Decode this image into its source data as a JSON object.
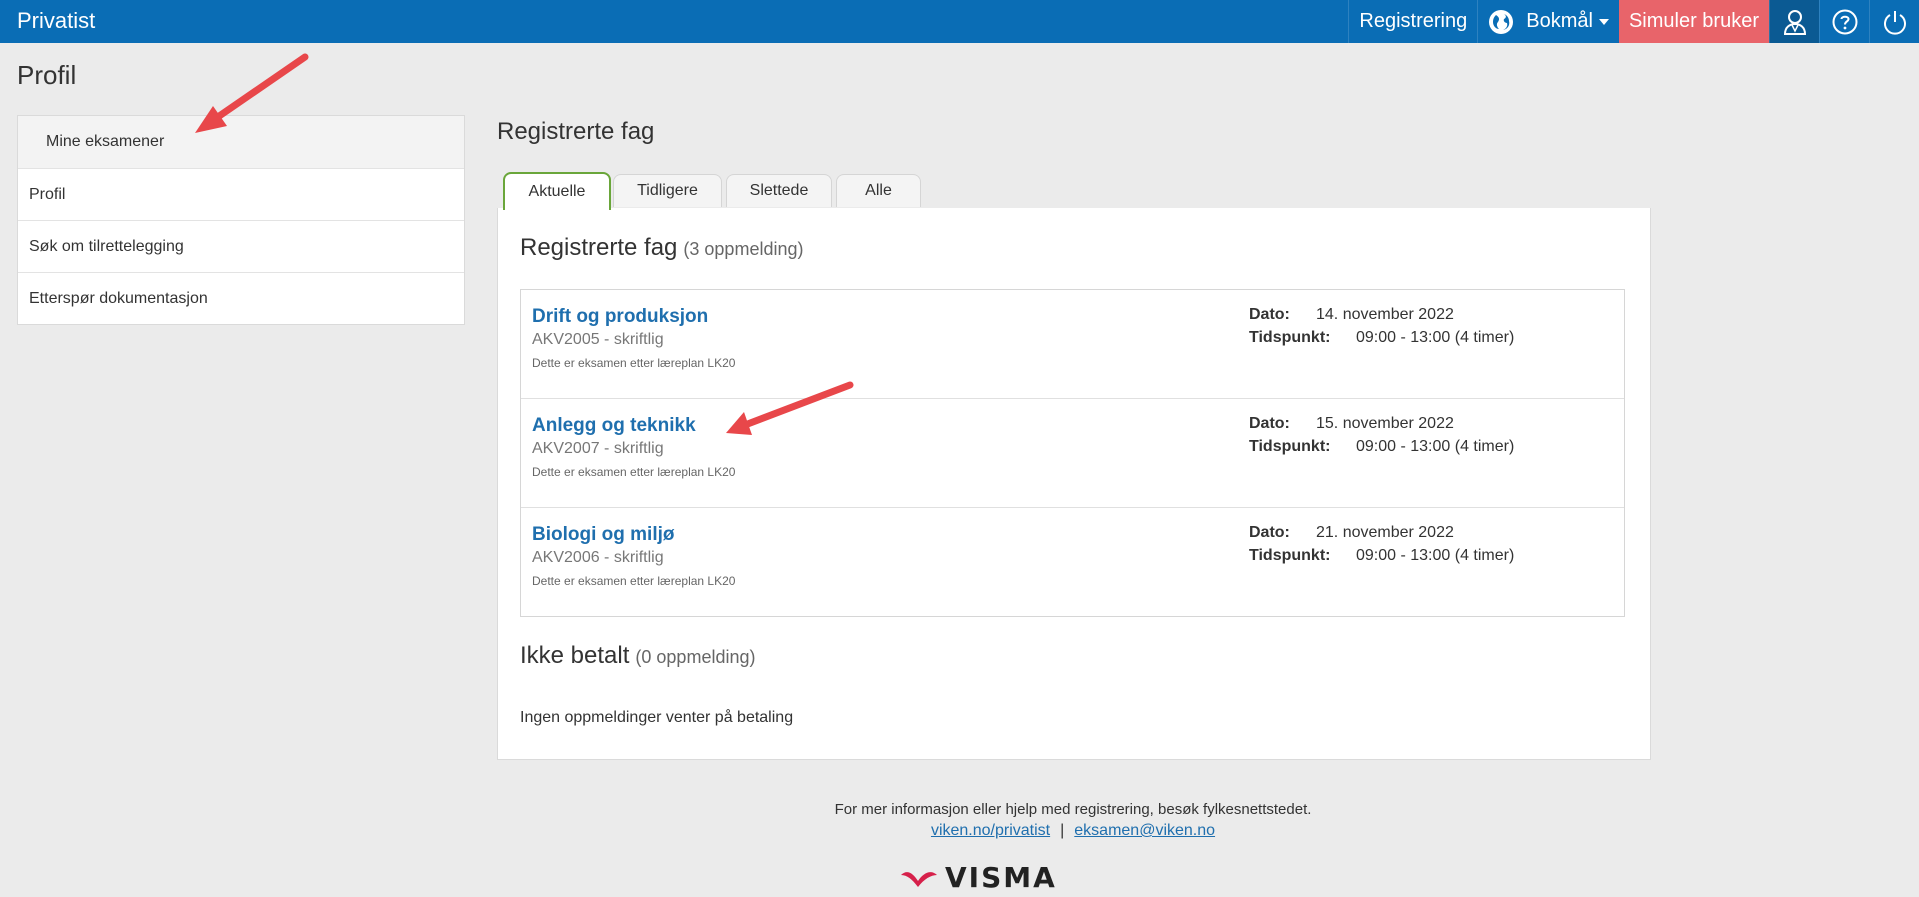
{
  "header": {
    "brand": "Privatist",
    "registrering": "Registrering",
    "language": "Bokmål",
    "simuler": "Simuler bruker"
  },
  "page_title": "Profil",
  "sidebar": {
    "items": [
      {
        "label": "Mine eksamener"
      },
      {
        "label": "Profil"
      },
      {
        "label": "Søk om tilrettelegging"
      },
      {
        "label": "Etterspør dokumentasjon"
      }
    ]
  },
  "main": {
    "title": "Registrerte fag",
    "tabs": [
      {
        "label": "Aktuelle"
      },
      {
        "label": "Tidligere"
      },
      {
        "label": "Slettede"
      },
      {
        "label": "Alle"
      }
    ],
    "registered": {
      "heading": "Registrerte fag",
      "count": "(3 oppmelding)",
      "date_label": "Dato:",
      "time_label": "Tidspunkt:",
      "rows": [
        {
          "name": "Drift og produksjon",
          "code": "AKV2005 - skriftlig",
          "note": "Dette er eksamen etter læreplan LK20",
          "date": "14. november 2022",
          "time": "09:00 - 13:00 (4 timer)"
        },
        {
          "name": "Anlegg og teknikk",
          "code": "AKV2007 - skriftlig",
          "note": "Dette er eksamen etter læreplan LK20",
          "date": "15. november 2022",
          "time": "09:00 - 13:00 (4 timer)"
        },
        {
          "name": "Biologi og miljø",
          "code": "AKV2006 - skriftlig",
          "note": "Dette er eksamen etter læreplan LK20",
          "date": "21. november 2022",
          "time": "09:00 - 13:00 (4 timer)"
        }
      ]
    },
    "unpaid": {
      "heading": "Ikke betalt",
      "count": "(0 oppmelding)",
      "empty": "Ingen oppmeldinger venter på betaling"
    }
  },
  "footer": {
    "info": "For mer informasjon eller hjelp med registrering, besøk fylkesnettstedet.",
    "link1": "viken.no/privatist",
    "separator": "|",
    "link2": "eksamen@viken.no",
    "logo": "VISMA"
  },
  "colors": {
    "navbar": "#0a6db5",
    "simuler": "#e8646a",
    "link": "#1f6fae",
    "tab_active_border": "#6aa63a",
    "annotation_arrow": "#e8474a"
  }
}
